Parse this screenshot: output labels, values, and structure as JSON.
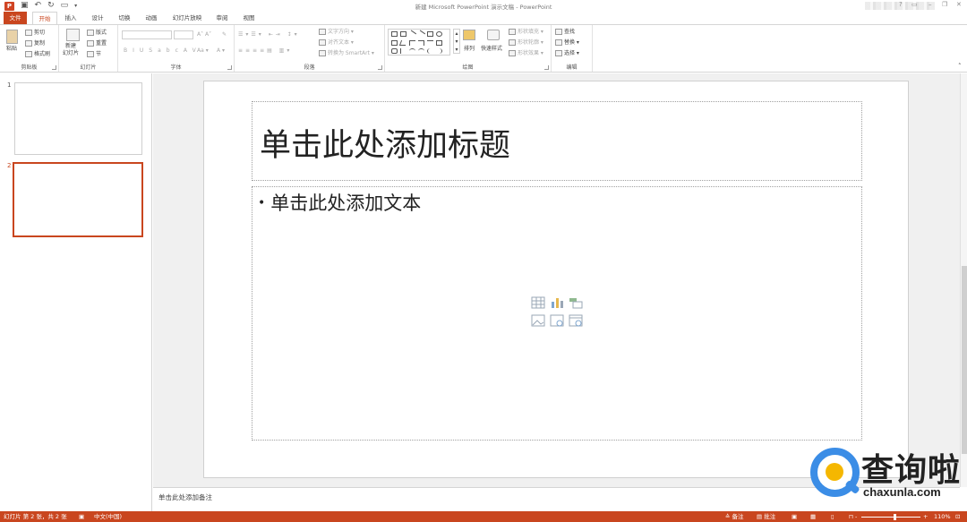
{
  "app": {
    "window_title": "新建 Microsoft PowerPoint 演示文稿 - PowerPoint",
    "window_controls": [
      "?",
      "▭",
      "–",
      "❐",
      "✕"
    ]
  },
  "ribbon_tabs": [
    "文件",
    "开始",
    "插入",
    "设计",
    "切换",
    "动画",
    "幻灯片放映",
    "审阅",
    "视图"
  ],
  "ribbon": {
    "clipboard": {
      "label": "剪贴板",
      "paste": "粘贴",
      "cut": "剪切",
      "copy": "复制",
      "format_painter": "格式刷"
    },
    "slides": {
      "label": "幻灯片",
      "new_slide": "新建\n幻灯片",
      "layout": "版式",
      "reset": "重置",
      "section": "节"
    },
    "font": {
      "label": "字体"
    },
    "paragraph": {
      "label": "段落",
      "text_direction": "文字方向",
      "align_text": "对齐文本",
      "smartart": "转换为 SmartArt"
    },
    "drawing": {
      "label": "绘图",
      "arrange": "排列",
      "quick_styles": "快速样式",
      "shape_fill": "形状填充",
      "shape_outline": "形状轮廓",
      "shape_effects": "形状效果"
    },
    "editing": {
      "label": "编辑",
      "find": "查找",
      "replace": "替换",
      "select": "选择"
    }
  },
  "thumbnails": [
    {
      "number": "1",
      "selected": false
    },
    {
      "number": "2",
      "selected": true
    }
  ],
  "slide": {
    "title_placeholder": "单击此处添加标题",
    "body_placeholder": "单击此处添加文本",
    "bullet": "•"
  },
  "notes_placeholder": "单击此处添加备注",
  "status_bar": {
    "slide_info": "幻灯片 第 2 张，共 2 张",
    "language": "中文(中国)",
    "notes": "备注",
    "comments": "批注",
    "zoom_minus": "-",
    "zoom_plus": "+",
    "zoom": "110%"
  },
  "watermark": {
    "text_cn": "查询啦",
    "text_en": "chaxunla.com"
  },
  "colors": {
    "accent": "#c9461f",
    "watermark_blue": "#3b8de6",
    "watermark_yellow": "#f5b700"
  }
}
